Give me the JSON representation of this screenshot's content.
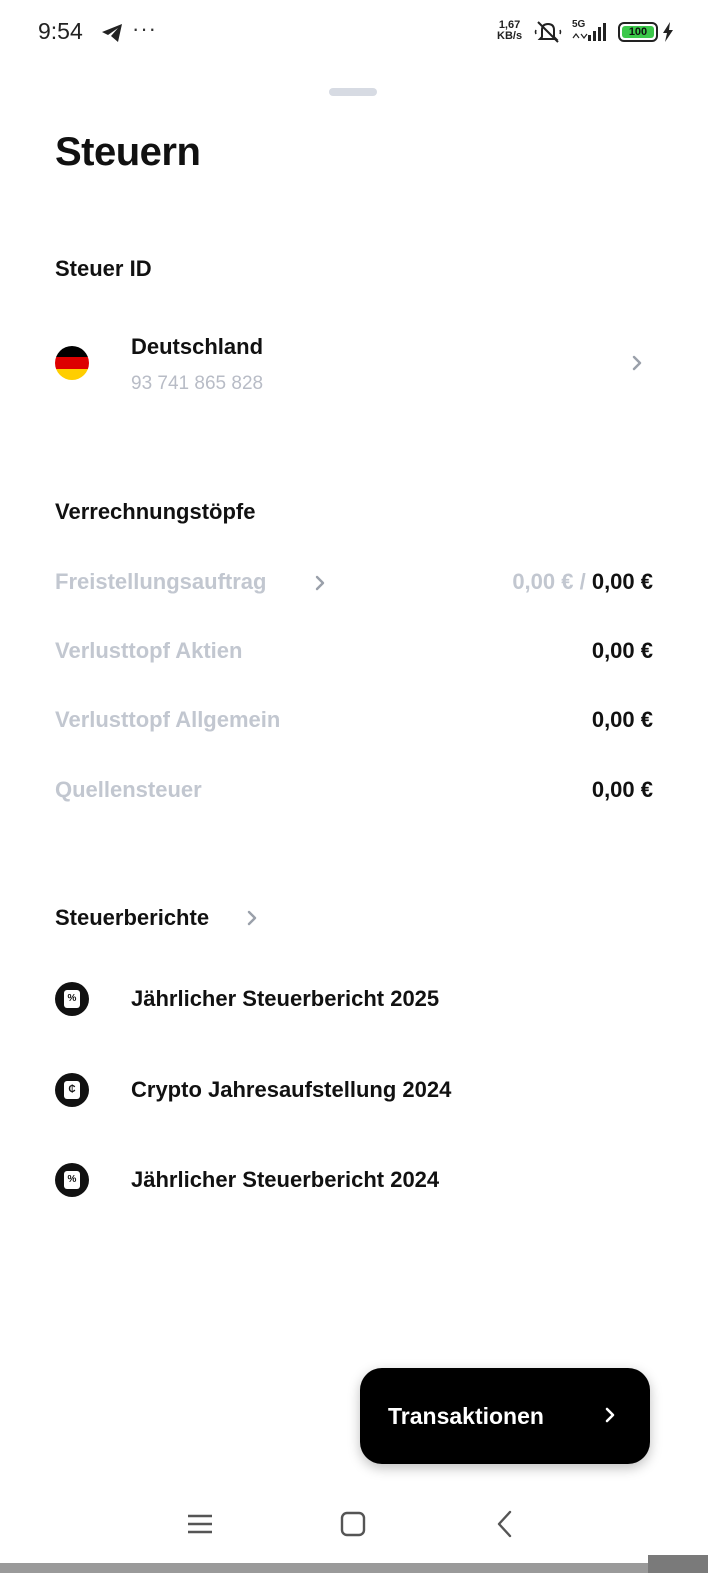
{
  "status_bar": {
    "time": "9:54",
    "dots": "···",
    "speed_value": "1,67",
    "speed_unit": "KB/s",
    "network": "5G",
    "battery": "100",
    "battery_color": "#3cc84a",
    "icons": [
      "telegram-icon",
      "mute-icon",
      "signal-icon",
      "battery-icon",
      "charging-icon"
    ]
  },
  "page": {
    "title": "Steuern"
  },
  "tax_id": {
    "section_title": "Steuer ID",
    "country": "Deutschland",
    "number": "93 741 865 828"
  },
  "pots": {
    "section_title": "Verrechnungstöpfe",
    "items": [
      {
        "label": "Freistellungsauftrag",
        "used": "0,00 € /",
        "value": "0,00 €"
      },
      {
        "label": "Verlusttopf Aktien",
        "value": "0,00 €"
      },
      {
        "label": "Verlusttopf Allgemein",
        "value": "0,00 €"
      },
      {
        "label": "Quellensteuer",
        "value": "0,00 €"
      }
    ]
  },
  "reports": {
    "section_title": "Steuerberichte",
    "items": [
      {
        "label": "Jährlicher Steuerbericht 2025",
        "icon": "percent-document-icon",
        "glyph": "%"
      },
      {
        "label": "Crypto Jahresaufstellung 2024",
        "icon": "crypto-document-icon",
        "glyph": "₵"
      },
      {
        "label": "Jährlicher Steuerbericht 2024",
        "icon": "percent-document-icon",
        "glyph": "%"
      }
    ]
  },
  "fab": {
    "label": "Transaktionen"
  },
  "colors": {
    "muted_text": "#c2c7d0",
    "secondary_text": "#b8bcc6",
    "primary_text": "#111111",
    "flag": [
      "#000000",
      "#dd0000",
      "#ffce00"
    ]
  }
}
